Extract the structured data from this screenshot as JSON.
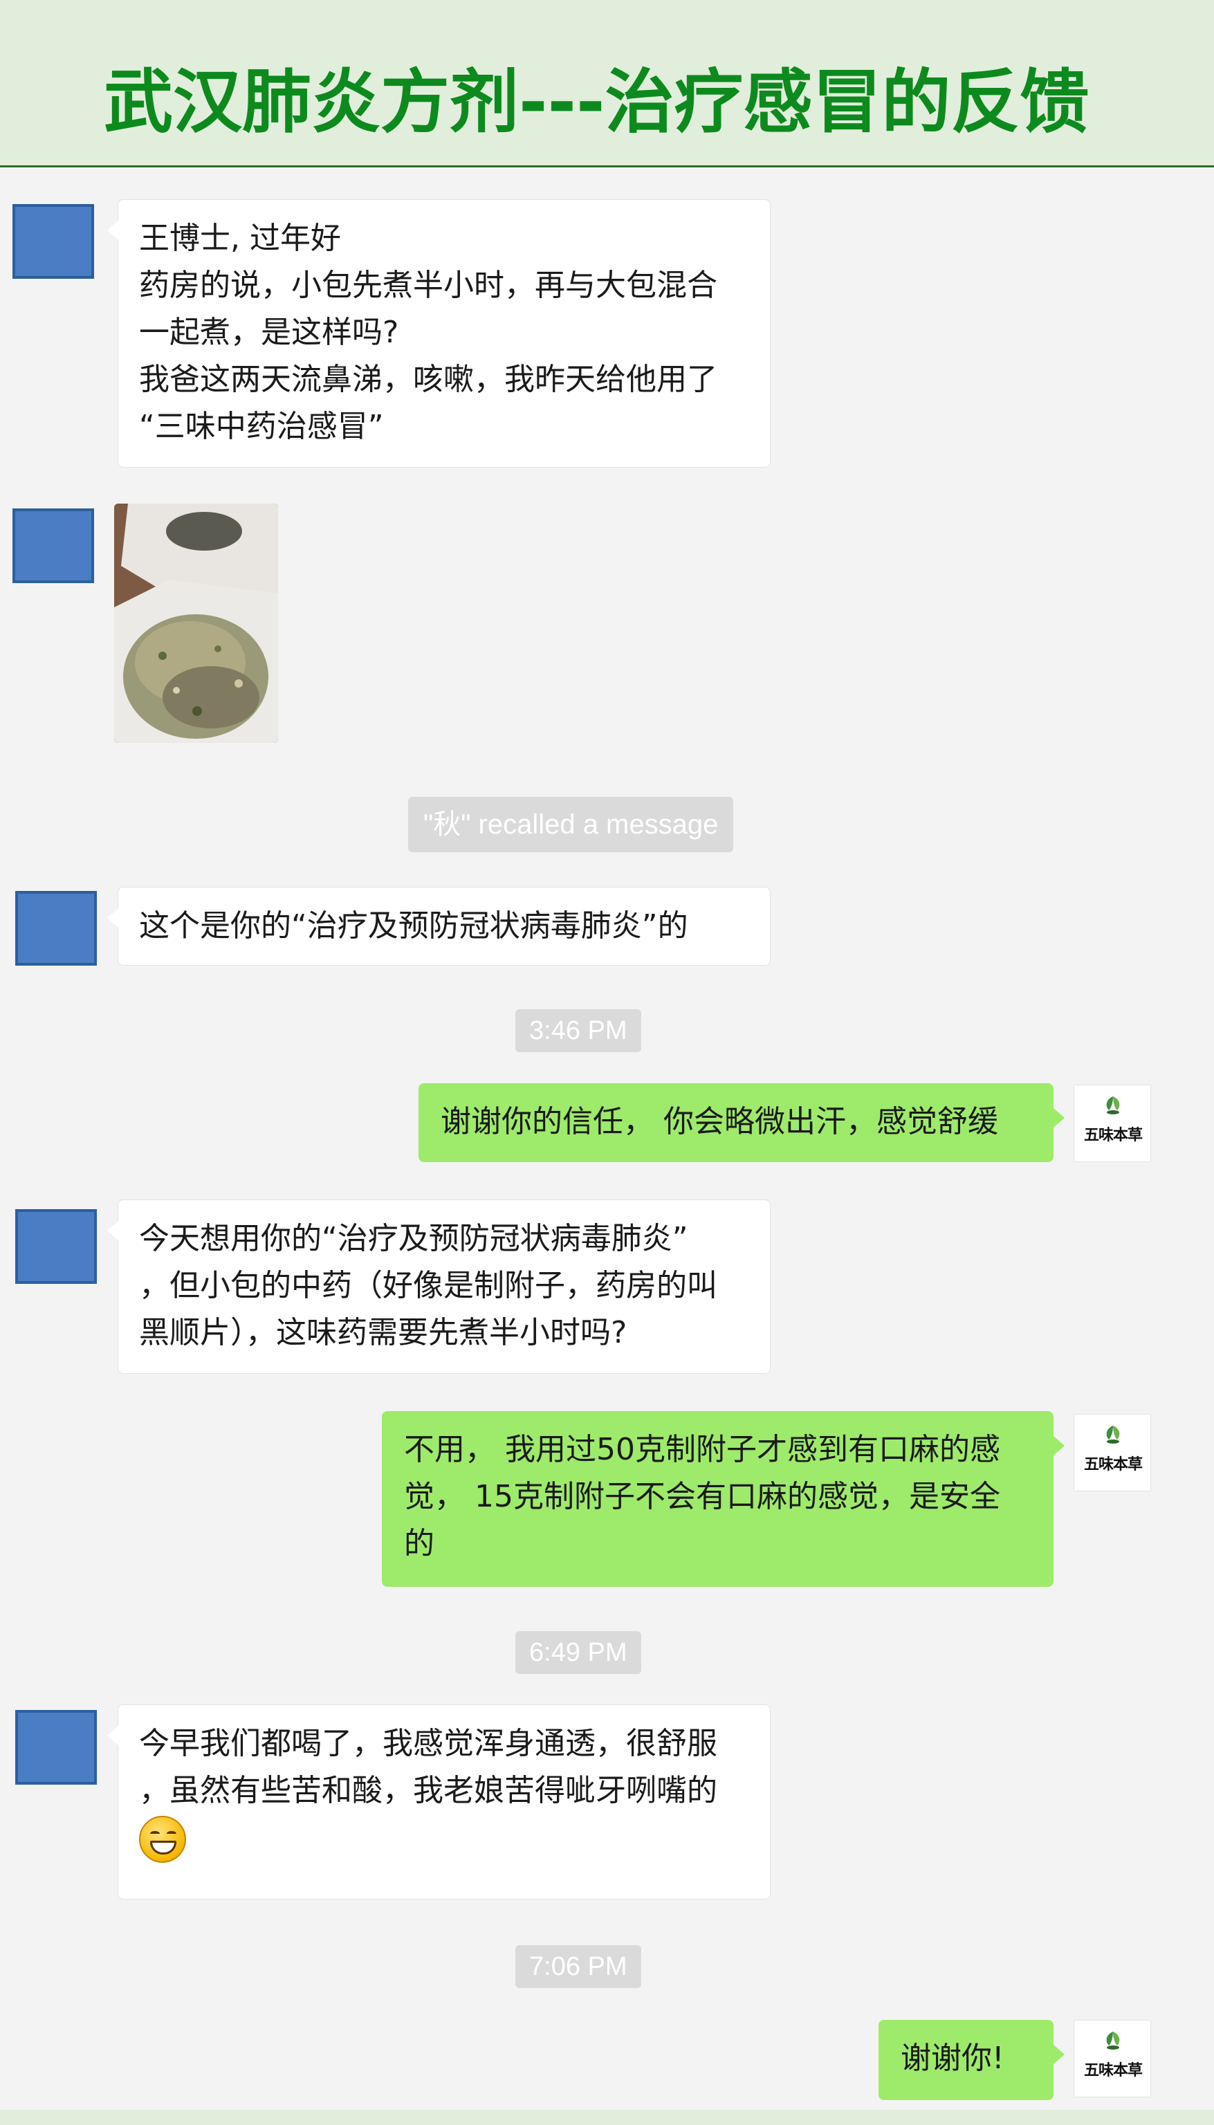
{
  "header": {
    "title": "武汉肺炎方剂---治疗感冒的反馈"
  },
  "messages": {
    "m1": {
      "lines": [
        "王博士, 过年好",
        "药房的说，小包先煮半小时，再与大包混合",
        "一起煮，是这样吗?",
        "我爸这两天流鼻涕，咳嗽，我昨天给他用了",
        "“三味中药治感冒”"
      ]
    },
    "recall": "\"秋\" recalled a message",
    "m3": {
      "text": "这个是你的“治疗及预防冠状病毒肺炎”的"
    },
    "t1": "3:46 PM",
    "m4": {
      "text": "谢谢你的信任， 你会略微出汗，感觉舒缓"
    },
    "m5": {
      "lines": [
        "今天想用你的“治疗及预防冠状病毒肺炎”",
        "，但小包的中药（好像是制附子，药房的叫",
        "黑顺片），这味药需要先煮半小时吗?"
      ]
    },
    "m6": {
      "lines": [
        "不用， 我用过50克制附子才感到有口麻的感",
        "觉， 15克制附子不会有口麻的感觉，是安全",
        "的"
      ]
    },
    "t2": "6:49 PM",
    "m7": {
      "lines": [
        "今早我们都喝了，我感觉浑身通透，很舒服",
        "，虽然有些苦和酸，我老娘苦得呲牙咧嘴的"
      ],
      "emoji": "grinning-face-emoji"
    },
    "t3": "7:06 PM",
    "m8": {
      "text": "谢谢你!"
    }
  },
  "self_avatar": {
    "logo_text": "五味本草",
    "icon": "leaf-icon"
  },
  "colors": {
    "header_bg": "#e2eedc",
    "title": "#0d8a1e",
    "outgoing_bubble": "#9eea6a",
    "avatar": "#4a7ec4"
  }
}
